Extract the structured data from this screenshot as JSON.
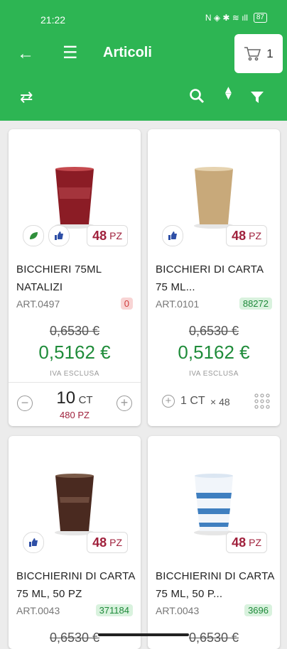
{
  "status_bar": {
    "time": "21:22",
    "icons": "N ◈ ✱ ≋ ıll",
    "battery": "87"
  },
  "header": {
    "title": "Articoli",
    "cart_count": "1"
  },
  "products": [
    {
      "name": "BICCHIERI 75ML NATALIZI",
      "code": "ART.0497",
      "stock": "0",
      "qty_num": "48",
      "qty_unit": "PZ",
      "old_price": "0,6530 €",
      "new_price": "0,5162 €",
      "vat": "IVA ESCLUSA",
      "order_qty": "10",
      "order_unit": "CT",
      "order_pieces": "480 PZ",
      "cup_color": "#8b1c25"
    },
    {
      "name": "BICCHIERI DI CARTA 75 ML...",
      "code": "ART.0101",
      "stock": "88272",
      "qty_num": "48",
      "qty_unit": "PZ",
      "old_price": "0,6530 €",
      "new_price": "0,5162 €",
      "vat": "IVA ESCLUSA",
      "pack_label": "1 CT",
      "pack_mult": "× 48",
      "cup_color": "#c8a97a"
    },
    {
      "name": "BICCHIERINI DI CARTA 75 ML, 50 PZ",
      "code": "ART.0043",
      "stock": "371184",
      "qty_num": "48",
      "qty_unit": "PZ",
      "old_price": "0,6530 €",
      "cup_color": "#4a2a20"
    },
    {
      "name": "BICCHIERINI DI CARTA 75 ML, 50 P...",
      "code": "ART.0043",
      "stock": "3696",
      "qty_num": "48",
      "qty_unit": "PZ",
      "old_price": "0,6530 €",
      "cup_color": "#3f7fc0"
    }
  ]
}
